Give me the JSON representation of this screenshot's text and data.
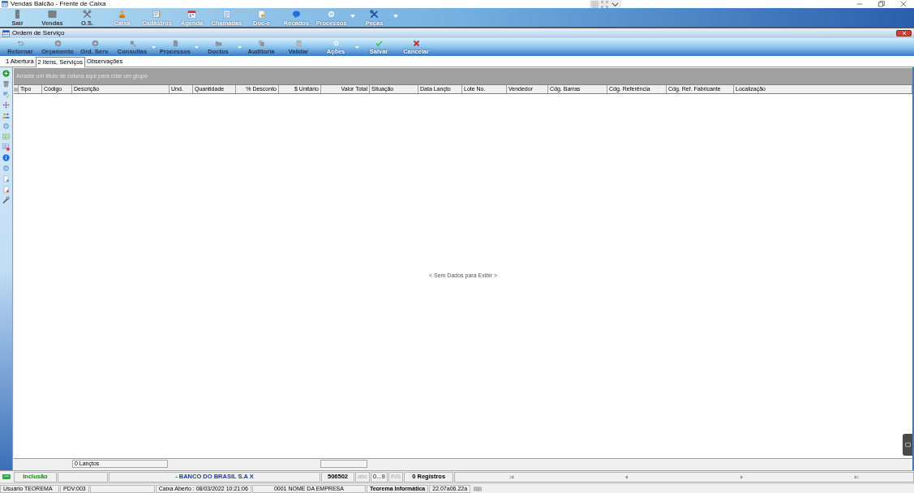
{
  "window": {
    "title": "Vendas Balcão - Frente de Caixa"
  },
  "main_toolbar": [
    {
      "label": "Sair",
      "disabled": true,
      "dropdown": false
    },
    {
      "label": "Vendas",
      "disabled": true,
      "dropdown": false
    },
    {
      "label": "O.S.",
      "disabled": true,
      "dropdown": false
    },
    {
      "label": "Caixa",
      "disabled": false,
      "dropdown": false
    },
    {
      "label": "Cadastros",
      "disabled": false,
      "dropdown": false
    },
    {
      "label": "Agenda",
      "disabled": false,
      "dropdown": false
    },
    {
      "label": "Chamadas",
      "disabled": false,
      "dropdown": false
    },
    {
      "label": "Doc-e",
      "disabled": false,
      "dropdown": false
    },
    {
      "label": "Recados",
      "disabled": false,
      "dropdown": false
    },
    {
      "label": "Processos",
      "disabled": false,
      "dropdown": true
    },
    {
      "label": "Peças",
      "disabled": false,
      "dropdown": true
    }
  ],
  "form": {
    "title": "Ordem de Serviço",
    "toolbar": [
      {
        "label": "Retornar",
        "disabled": true,
        "dropdown": false
      },
      {
        "label": "Orçamento",
        "disabled": true,
        "dropdown": false
      },
      {
        "label": "Ord. Serv.",
        "disabled": true,
        "dropdown": false
      },
      {
        "label": "Consultas",
        "disabled": true,
        "dropdown": true
      },
      {
        "label": "Processos",
        "disabled": true,
        "dropdown": true
      },
      {
        "label": "Doctos",
        "disabled": true,
        "dropdown": true
      },
      {
        "label": "Auditoria",
        "disabled": true,
        "dropdown": false
      },
      {
        "label": "Validar",
        "disabled": true,
        "dropdown": false
      },
      {
        "label": "Ações",
        "disabled": false,
        "dropdown": true
      },
      {
        "label": "Salvar",
        "disabled": false,
        "dropdown": false
      },
      {
        "label": "Cancelar",
        "disabled": false,
        "dropdown": false
      }
    ],
    "tabs": [
      {
        "label": "1 Abertura",
        "selected": false
      },
      {
        "label": "2 Itens, Serviços",
        "selected": true
      },
      {
        "label": "Observações",
        "selected": false
      }
    ],
    "grid": {
      "group_hint": "Arraste um título de coluna aqui para criar um grupo",
      "columns": [
        {
          "label": "Tipo",
          "kind": "text"
        },
        {
          "label": "Código",
          "kind": "text"
        },
        {
          "label": "Descrição",
          "kind": "text"
        },
        {
          "label": "Und.",
          "kind": "text"
        },
        {
          "label": "Quantidade",
          "kind": "text"
        },
        {
          "label": "% Desconto",
          "kind": "numeric"
        },
        {
          "label": "$ Unitário",
          "kind": "numeric"
        },
        {
          "label": "Valor Total",
          "kind": "numeric"
        },
        {
          "label": "Situação",
          "kind": "text"
        },
        {
          "label": "Data Lançto",
          "kind": "text"
        },
        {
          "label": "Lote No.",
          "kind": "text"
        },
        {
          "label": "Vendedor",
          "kind": "text"
        },
        {
          "label": "Cdg. Barras",
          "kind": "text"
        },
        {
          "label": "Cdg. Referência",
          "kind": "text"
        },
        {
          "label": "Cdg. Ref. Fabricante",
          "kind": "text"
        },
        {
          "label": "Localização",
          "kind": "text"
        }
      ],
      "empty_message": "< Sem Dados para Exibir >",
      "footer_count": "0 Lançtos"
    },
    "record_bar": {
      "mode": "Inclusão",
      "bank": "- BANCO DO BRASIL S.A X",
      "code": "506502",
      "indicators": [
        {
          "label": "abc",
          "on": false
        },
        {
          "label": "0...9",
          "on": true
        },
        {
          "label": "INS",
          "on": false
        }
      ],
      "records": "0 Registros"
    }
  },
  "status_bar": {
    "user": "Usuário TEOREMA",
    "pdv": "PDV:003",
    "cash": "Caixa Aberto : 08/03/2022 10:21:06",
    "company": "0001 NOME DA EMPRESA",
    "vendor": "Teorema Informática",
    "version": "22.07a06.22a"
  }
}
